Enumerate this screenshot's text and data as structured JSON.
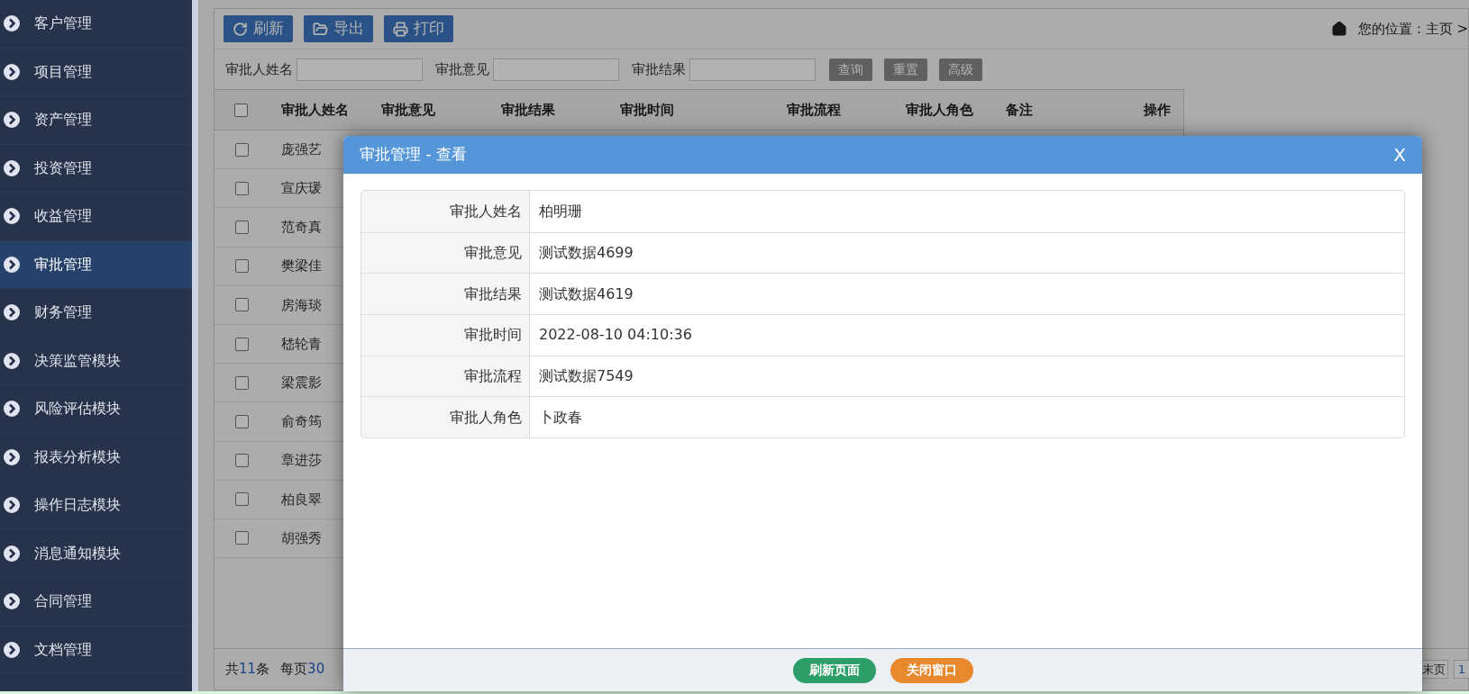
{
  "sidebar": {
    "items": [
      {
        "label": "客户管理",
        "selected": false
      },
      {
        "label": "项目管理",
        "selected": false
      },
      {
        "label": "资产管理",
        "selected": false
      },
      {
        "label": "投资管理",
        "selected": false
      },
      {
        "label": "收益管理",
        "selected": false
      },
      {
        "label": "审批管理",
        "selected": true
      },
      {
        "label": "财务管理",
        "selected": false
      },
      {
        "label": "决策监管模块",
        "selected": false
      },
      {
        "label": "风险评估模块",
        "selected": false
      },
      {
        "label": "报表分析模块",
        "selected": false
      },
      {
        "label": "操作日志模块",
        "selected": false
      },
      {
        "label": "消息通知模块",
        "selected": false
      },
      {
        "label": "合同管理",
        "selected": false
      },
      {
        "label": "文档管理",
        "selected": false
      }
    ]
  },
  "toolbar": {
    "buttons": [
      {
        "kind": "refresh",
        "label": "刷新"
      },
      {
        "kind": "export",
        "label": "导出"
      },
      {
        "kind": "print",
        "label": "打印"
      }
    ],
    "breadcrumb": "您的位置：主页 >"
  },
  "search": {
    "fields": [
      {
        "label": "审批人姓名"
      },
      {
        "label": "审批意见"
      },
      {
        "label": "审批结果"
      }
    ],
    "buttons": [
      "查询",
      "重置",
      "高级"
    ]
  },
  "table": {
    "select_all_checked": false,
    "columns": [
      "审批人姓名",
      "审批意见",
      "审批结果",
      "审批时间",
      "审批流程",
      "审批人角色",
      "备注",
      "操作"
    ],
    "rows": [
      {
        "name": "庞强艺",
        "checked": false
      },
      {
        "name": "宣庆瑗",
        "checked": false
      },
      {
        "name": "范奇真",
        "checked": false
      },
      {
        "name": "樊梁佳",
        "checked": false
      },
      {
        "name": "房海琰",
        "checked": false
      },
      {
        "name": "嵇轮青",
        "checked": false
      },
      {
        "name": "梁震影",
        "checked": false
      },
      {
        "name": "俞奇筠",
        "checked": false
      },
      {
        "name": "章进莎",
        "checked": false
      },
      {
        "name": "柏良翠",
        "checked": false
      },
      {
        "name": "胡强秀",
        "checked": false
      }
    ]
  },
  "footer": {
    "total_label": "共",
    "total": "11",
    "total_unit": "条",
    "per_page_label": "每页",
    "per_page": "30",
    "last_page": "末页",
    "page": "1"
  },
  "modal": {
    "title": "审批管理 - 查看",
    "close": "X",
    "fields": [
      {
        "label": "审批人姓名",
        "value": "柏明珊"
      },
      {
        "label": "审批意见",
        "value": "测试数据4699"
      },
      {
        "label": "审批结果",
        "value": "测试数据4619"
      },
      {
        "label": "审批时间",
        "value": "2022-08-10 04:10:36"
      },
      {
        "label": "审批流程",
        "value": "测试数据7549"
      },
      {
        "label": "审批人角色",
        "value": "卜政春"
      }
    ],
    "buttons": [
      {
        "kind": "primary",
        "label": "刷新页面"
      },
      {
        "kind": "secondary",
        "label": "关闭窗口"
      }
    ]
  }
}
